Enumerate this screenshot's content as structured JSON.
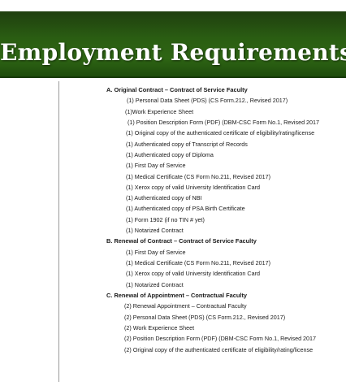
{
  "header": {
    "title": "Employment Requirements"
  },
  "sections": [
    {
      "heading": "A.   Original Contract – Contract of Service Faculty",
      "items": [
        "(1)  Personal Data Sheet (PDS) (CS Form.212., Revised 2017)",
        "(1)Work Experience Sheet",
        "(1)  Position Description Form (PDF) (DBM-CSC Form No.1, Revised 2017",
        "(1)  Original copy of the authenticated certificate of eligibility/rating/license",
        "(1)  Authenticated copy of Transcript of Records",
        "(1)  Authenticated copy of Diploma",
        "(1)  First Day of Service",
        "(1)  Medical Certificate (CS Form No.211, Revised 2017)",
        "(1)  Xerox copy of valid University Identification Card",
        "(1)  Authenticated copy of NBI",
        "(1)  Authenticated copy of PSA Birth Certificate",
        "(1)  Form 1902 (if no TIN # yet)",
        "(1)  Notarized Contract"
      ]
    },
    {
      "heading": "B.   Renewal of Contract – Contract of Service Faculty",
      "items": [
        "(1)  First Day of Service",
        "(1)  Medical Certificate (CS Form No.211, Revised 2017)",
        "(1)  Xerox copy of valid University Identification Card",
        "(1)  Notarized Contract"
      ]
    },
    {
      "heading": "C.   Renewal of Appointment – Contractual Faculty",
      "items": [
        "(2)  Renewal Appointment – Contractual Faculty",
        "(2)  Personal Data Sheet (PDS) (CS Form.212., Revised 2017)",
        "(2)  Work Experience Sheet",
        "(2)  Position Description Form (PDF) (DBM-CSC Form No.1, Revised 2017",
        "(2)  Original copy of the authenticated certificate of eligibility/rating/license"
      ]
    }
  ],
  "colors": {
    "banner_green": "#2a5d12",
    "text": "#1a1a1a",
    "background": "#ffffff"
  }
}
